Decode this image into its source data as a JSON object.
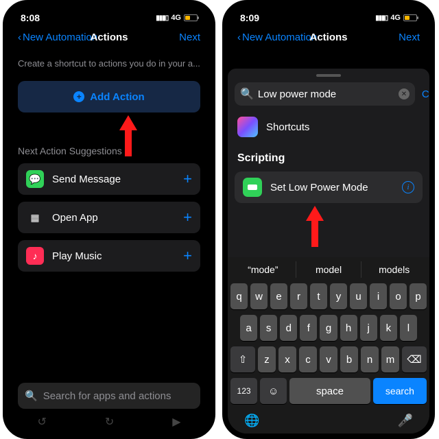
{
  "left": {
    "status_time": "8:08",
    "status_net": "4G",
    "back_label": "New Automation",
    "title": "Actions",
    "next_label": "Next",
    "subtitle": "Create a shortcut to actions you do in your a...",
    "add_action": "Add Action",
    "section": "Next Action Suggestions",
    "suggestions": [
      {
        "label": "Send Message",
        "icon_bg": "#30d158",
        "glyph": "💬"
      },
      {
        "label": "Open App",
        "icon_bg": "#1c1c1e",
        "glyph": "▦"
      },
      {
        "label": "Play Music",
        "icon_bg": "#ff2d55",
        "glyph": "♪"
      }
    ],
    "search_placeholder": "Search for apps and actions"
  },
  "right": {
    "status_time": "8:09",
    "status_net": "4G",
    "back_label": "New Automation",
    "title": "Actions",
    "next_label": "Next",
    "search_value": "Low power mode",
    "cancel": "Cancel",
    "app_label": "Shortcuts",
    "group": "Scripting",
    "result": "Set Low Power Mode",
    "predictions": [
      "“mode”",
      "model",
      "models"
    ],
    "rows": [
      [
        "q",
        "w",
        "e",
        "r",
        "t",
        "y",
        "u",
        "i",
        "o",
        "p"
      ],
      [
        "a",
        "s",
        "d",
        "f",
        "g",
        "h",
        "j",
        "k",
        "l"
      ],
      [
        "z",
        "x",
        "c",
        "v",
        "b",
        "n",
        "m"
      ]
    ],
    "space": "space",
    "search_key": "search",
    "num_key": "123"
  }
}
